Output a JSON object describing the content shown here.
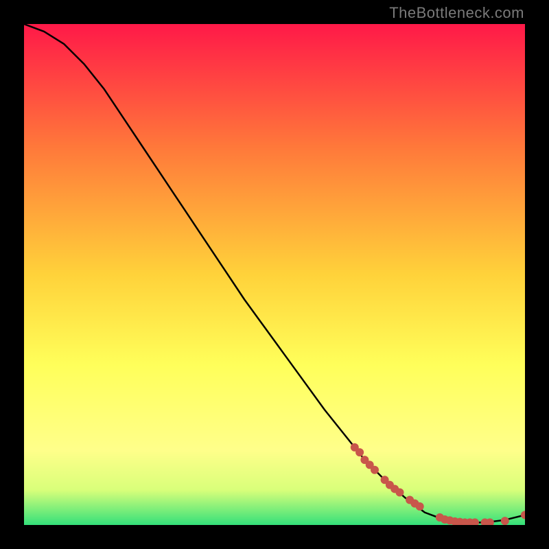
{
  "watermark": "TheBottleneck.com",
  "colors": {
    "bg_frame": "#000000",
    "grad_top": "#ff1948",
    "grad_mid1": "#ff7a3a",
    "grad_mid2": "#ffd23a",
    "grad_mid3": "#ffff5a",
    "grad_mid4": "#d9ff7a",
    "grad_bottom": "#34e07a",
    "curve": "#000000",
    "marker": "#c8564b"
  },
  "chart_data": {
    "type": "line",
    "title": "",
    "xlabel": "",
    "ylabel": "",
    "xlim": [
      0,
      100
    ],
    "ylim": [
      0,
      100
    ],
    "grid": false,
    "legend": null,
    "series": [
      {
        "name": "curve",
        "x": [
          0,
          4,
          8,
          12,
          16,
          20,
          24,
          28,
          32,
          36,
          40,
          44,
          48,
          52,
          56,
          60,
          64,
          68,
          72,
          76,
          80,
          84,
          88,
          92,
          96,
          100
        ],
        "y": [
          100,
          98.5,
          96,
          92,
          87,
          81,
          75,
          69,
          63,
          57,
          51,
          45,
          39.5,
          34,
          28.5,
          23,
          18,
          13,
          9,
          5.5,
          2.5,
          1,
          0.5,
          0.5,
          1,
          2
        ]
      }
    ],
    "markers": {
      "name": "dots",
      "x": [
        66,
        67,
        68,
        69,
        70,
        72,
        73,
        74,
        75,
        77,
        78,
        79,
        83,
        84,
        85,
        86,
        87,
        88,
        89,
        90,
        92,
        93,
        96,
        100
      ],
      "y": [
        15.5,
        14.5,
        13,
        12,
        11,
        9,
        8,
        7.2,
        6.5,
        5,
        4.3,
        3.7,
        1.5,
        1.1,
        0.9,
        0.7,
        0.6,
        0.5,
        0.5,
        0.5,
        0.5,
        0.5,
        0.8,
        2
      ]
    }
  }
}
